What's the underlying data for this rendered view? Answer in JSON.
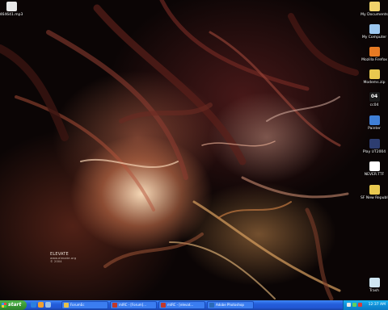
{
  "desktop": {
    "icons_left": [
      {
        "name": "mp3-file-icon",
        "label": "464641.mp3",
        "color": "#e8e8e8"
      }
    ],
    "icons_right": [
      {
        "name": "my-documents-icon",
        "label": "My Documents",
        "color": "#f1d36b"
      },
      {
        "name": "my-computer-icon",
        "label": "My Computer",
        "color": "#9cc7ef"
      },
      {
        "name": "mozilla-firefox-icon",
        "label": "Mozilla Firefox",
        "color": "#e77a23"
      },
      {
        "name": "folder-icon",
        "label": "Modems.zip",
        "color": "#e9c84f"
      },
      {
        "name": "ccd4-icon",
        "label": "cc04",
        "color": "#1a1a1a",
        "text": "04"
      },
      {
        "name": "painter-icon",
        "label": "Painter",
        "color": "#3f7fd6"
      },
      {
        "name": "unreal-tournament-icon",
        "label": "Play UT2004",
        "color": "#2d3d70"
      },
      {
        "name": "text-document-icon",
        "label": "NEVER.TTF",
        "color": "#ffffff"
      },
      {
        "name": "republic-folder-icon",
        "label": "SF New Republic v1.0",
        "color": "#e9c84f"
      },
      {
        "name": "recycle-bin-icon",
        "label": "Trash",
        "color": "#cfe6f2"
      }
    ],
    "signature": {
      "line1": "ELEVATE",
      "line2": "www.elevate.org",
      "line3": "© 2004"
    }
  },
  "taskbar": {
    "start_label": "start",
    "tasks": [
      {
        "label": "ForumEc",
        "color": "#e6c14b"
      },
      {
        "label": "mIRC - [Forum]...",
        "color": "#c0392b"
      },
      {
        "label": "mIRC - [elevat...",
        "color": "#c0392b"
      },
      {
        "label": "Adobe Photoshop",
        "color": "#2a6ab8"
      }
    ],
    "clock": "12:37 AM"
  },
  "colors": {
    "taskbar": "#245edb",
    "start": "#3a9a36",
    "tray": "#0f8fd8"
  }
}
